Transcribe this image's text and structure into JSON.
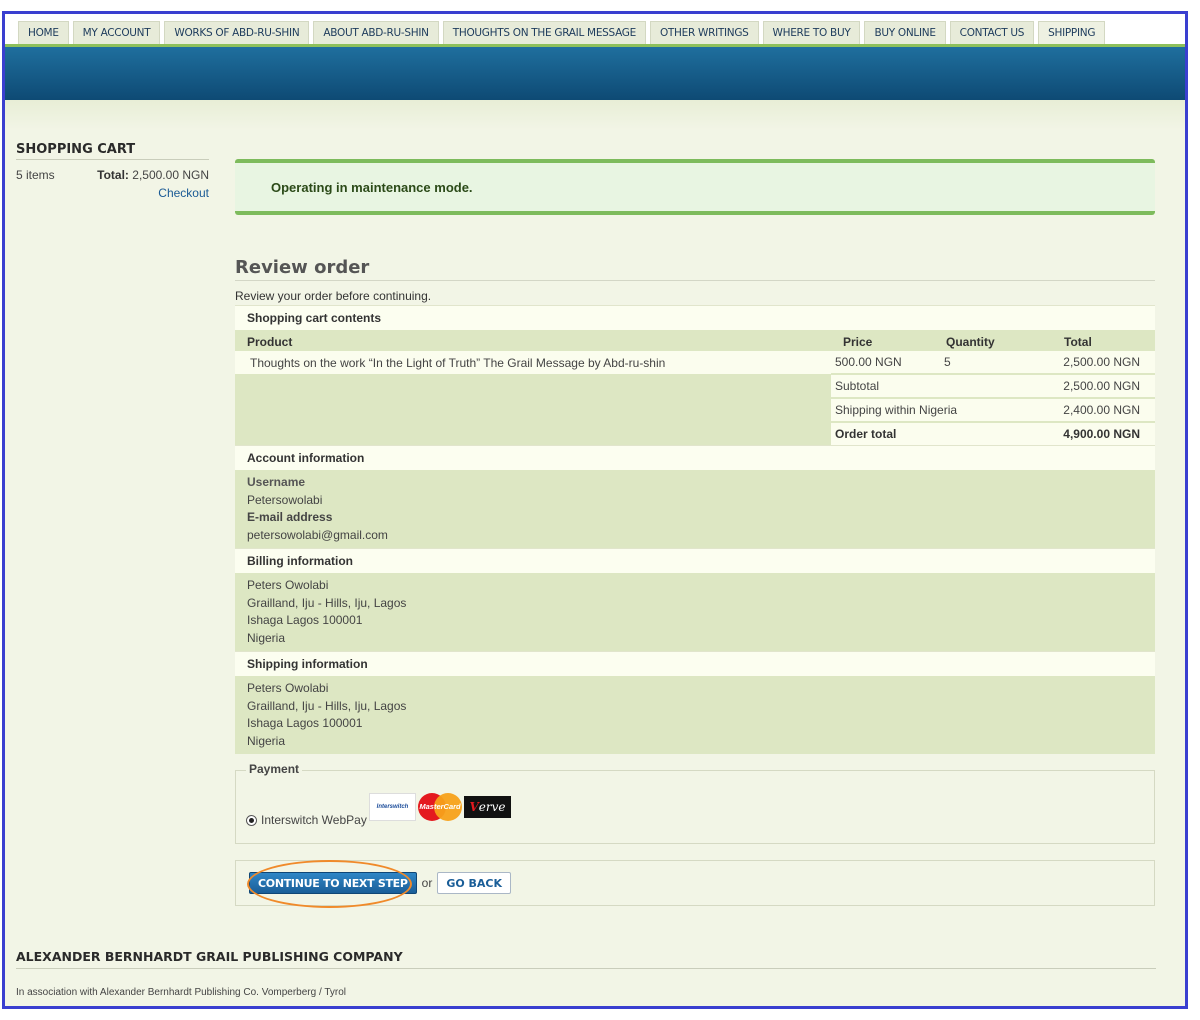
{
  "nav": {
    "items": [
      "HOME",
      "MY ACCOUNT",
      "WORKS OF ABD-RU-SHIN",
      "ABOUT ABD-RU-SHIN",
      "THOUGHTS ON THE GRAIL MESSAGE",
      "OTHER WRITINGS",
      "WHERE TO BUY",
      "BUY ONLINE",
      "CONTACT US",
      "SHIPPING"
    ]
  },
  "sidebar": {
    "title": "SHOPPING CART",
    "items_count": "5 items",
    "total_label": "Total:",
    "total_value": "2,500.00 NGN",
    "checkout": "Checkout"
  },
  "status": {
    "message": "Operating in maintenance mode."
  },
  "review": {
    "title": "Review order",
    "subtitle": "Review your order before continuing.",
    "cart_section": "Shopping cart contents",
    "columns": {
      "product": "Product",
      "price": "Price",
      "quantity": "Quantity",
      "total": "Total"
    },
    "item": {
      "product": "Thoughts on the work “In the Light of Truth” The Grail Message by Abd-ru-shin",
      "price": "500.00 NGN",
      "quantity": "5",
      "total": "2,500.00 NGN"
    },
    "subtotal_label": "Subtotal",
    "subtotal_value": "2,500.00 NGN",
    "shipping_label": "Shipping within Nigeria",
    "shipping_value": "2,400.00 NGN",
    "order_total_label": "Order total",
    "order_total_value": "4,900.00 NGN"
  },
  "account": {
    "section": "Account information",
    "username_label": "Username",
    "username": "Petersowolabi",
    "email_label": "E-mail address",
    "email": "petersowolabi@gmail.com"
  },
  "billing": {
    "section": "Billing information",
    "name": "Peters Owolabi",
    "street": "Grailland, Iju - Hills, Iju, Lagos",
    "city": "Ishaga Lagos 100001",
    "country": "Nigeria"
  },
  "shipping": {
    "section": "Shipping information",
    "name": "Peters Owolabi",
    "street": "Grailland, Iju - Hills, Iju, Lagos",
    "city": "Ishaga Lagos 100001",
    "country": "Nigeria"
  },
  "payment": {
    "legend": "Payment",
    "option": "Interswitch WebPay",
    "logo_interswitch": "Interswitch",
    "logo_mastercard": "MasterCard",
    "logo_verve_prefix": "V",
    "logo_verve_rest": "erve"
  },
  "actions": {
    "continue": "CONTINUE TO NEXT STEP",
    "or": "or",
    "back": "GO BACK"
  },
  "footer": {
    "company": "ALEXANDER BERNHARDT GRAIL PUBLISHING COMPANY",
    "note": "In association with Alexander Bernhardt Publishing Co. Vomperberg / Tyrol"
  }
}
